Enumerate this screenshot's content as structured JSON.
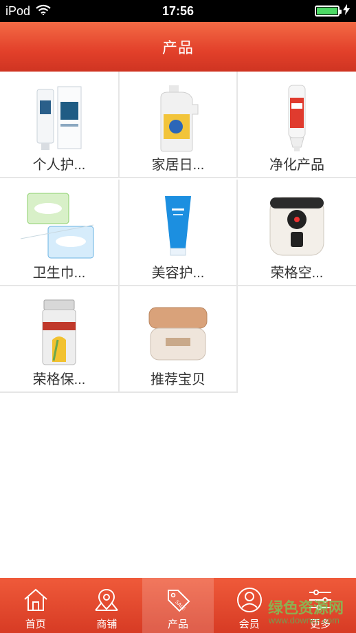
{
  "status_bar": {
    "carrier": "iPod",
    "time": "17:56"
  },
  "header": {
    "title": "产品"
  },
  "products": [
    {
      "label": "个人护...",
      "icon": "tube-box-icon"
    },
    {
      "label": "家居日...",
      "icon": "detergent-bottle-icon"
    },
    {
      "label": "净化产品",
      "icon": "purifier-cartridge-icon"
    },
    {
      "label": "卫生巾...",
      "icon": "sanitary-pad-pack-icon"
    },
    {
      "label": "美容护...",
      "icon": "blue-tube-icon"
    },
    {
      "label": "荣格空...",
      "icon": "air-fryer-icon"
    },
    {
      "label": "荣格保...",
      "icon": "supplement-bottle-icon"
    },
    {
      "label": "推荐宝贝",
      "icon": "cream-jar-icon"
    }
  ],
  "tabbar": {
    "items": [
      {
        "label": "首页",
        "icon": "home-icon"
      },
      {
        "label": "商铺",
        "icon": "map-pin-icon"
      },
      {
        "label": "产品",
        "icon": "sale-tag-icon",
        "active": true
      },
      {
        "label": "会员",
        "icon": "member-icon"
      },
      {
        "label": "更多",
        "icon": "sliders-icon"
      }
    ]
  },
  "watermark": {
    "title": "绿色资源网",
    "url": "www.downcc.com"
  },
  "colors": {
    "header": "#e2402a",
    "tabbar": "#d73b24",
    "battery": "#4cd964"
  }
}
